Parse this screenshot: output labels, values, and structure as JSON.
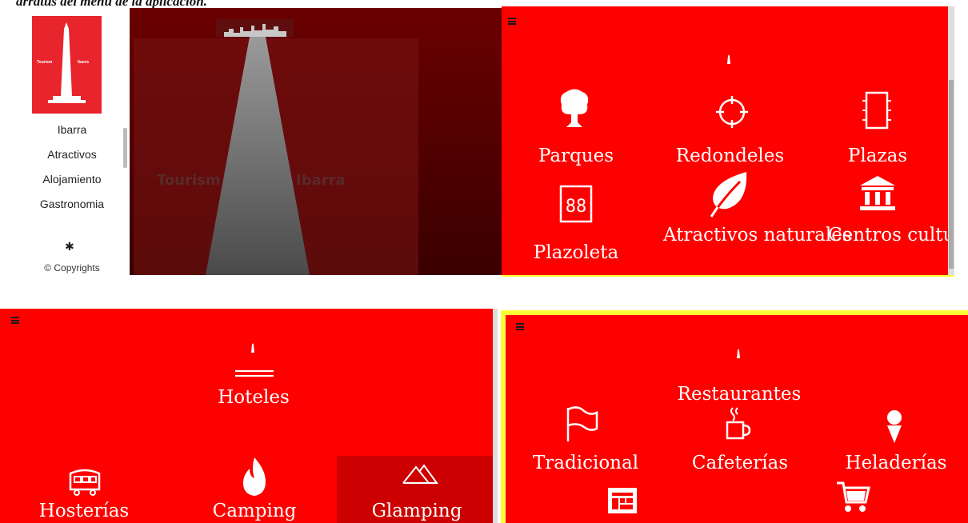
{
  "caption": "arratus del menú de la aplicación.",
  "sidebar": {
    "logo_left": "Tourism",
    "logo_right": "Ibarra",
    "items": [
      "Ibarra",
      "Atractivos",
      "Alojamiento",
      "Gastronomia"
    ],
    "copyright": "© Copyrights"
  },
  "splash": {
    "left_word": "Tourism",
    "right_word": "Ibarra"
  },
  "atractivos": {
    "items": [
      {
        "label": "Parques",
        "icon": "tree-icon"
      },
      {
        "label": "Redondeles",
        "icon": "crosshair-icon"
      },
      {
        "label": "Plazas",
        "icon": "chip-icon"
      },
      {
        "label": "Plazoleta",
        "icon": "digital-88-icon"
      },
      {
        "label": "Atractivos naturales",
        "icon": "leaf-icon"
      },
      {
        "label": "Centros culturales",
        "icon": "museum-icon"
      }
    ]
  },
  "alojamiento": {
    "items": [
      {
        "label": "Hoteles",
        "icon": "hotel-icon"
      },
      {
        "label": "Hosterías",
        "icon": "caravan-icon"
      },
      {
        "label": "Camping",
        "icon": "fire-icon"
      },
      {
        "label": "Glamping",
        "icon": "mountains-icon"
      }
    ],
    "selected": "Glamping"
  },
  "gastronomia": {
    "items": [
      {
        "label": "Restaurantes",
        "icon": ""
      },
      {
        "label": "Tradicional",
        "icon": "flag-icon"
      },
      {
        "label": "Cafeterías",
        "icon": "coffee-icon"
      },
      {
        "label": "Heladerías",
        "icon": "ice-cream-icon"
      },
      {
        "label": "",
        "icon": "newspaper-icon"
      },
      {
        "label": "",
        "icon": "cart-icon"
      }
    ]
  },
  "colors": {
    "primary": "#ff0000",
    "highlight": "#ffff33",
    "selected": "#cc0000"
  }
}
